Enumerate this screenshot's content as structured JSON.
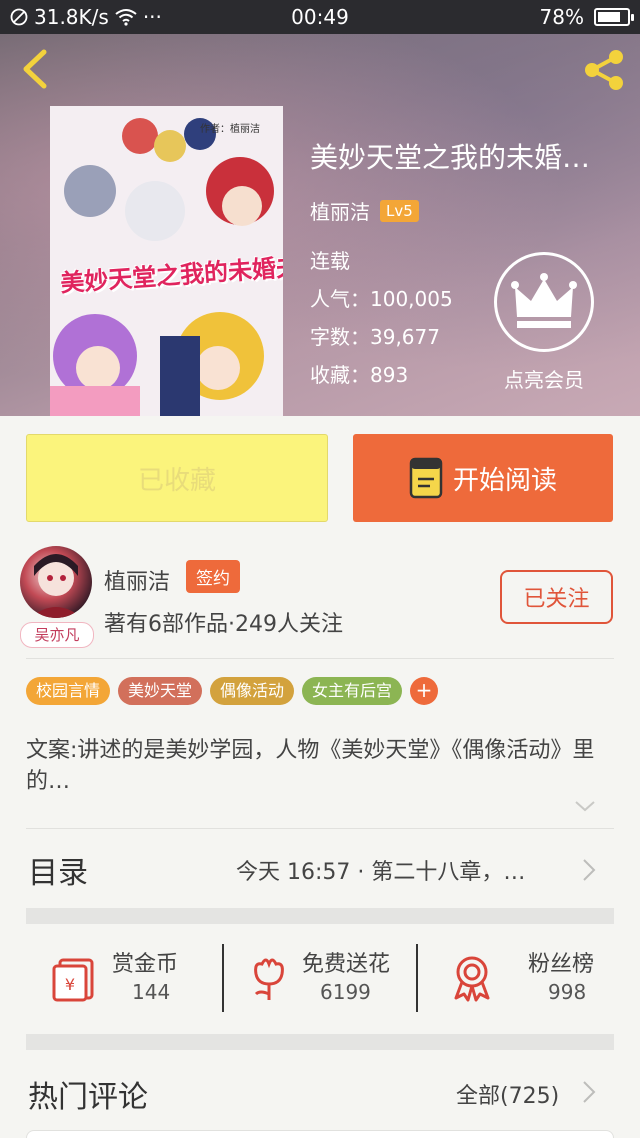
{
  "status_bar": {
    "speed": "31.8K/s",
    "dots": "···",
    "time": "00:49",
    "battery": "78%",
    "battery_level": 0.78
  },
  "book": {
    "title": "美妙天堂之我的未婚…",
    "author": "植丽洁",
    "level": "Lv5",
    "status": "连载",
    "popularity": "人气：100,005",
    "word_count": "字数：39,677",
    "favorites": "收藏：893",
    "cover_title_art": "美妙天堂之我的未婚夫之路",
    "cover_author": "作者：植丽洁",
    "vip_label": "点亮会员"
  },
  "actions": {
    "favorited_label": "已收藏",
    "read_label": "开始阅读"
  },
  "author_section": {
    "name": "植丽洁",
    "sign_badge": "签约",
    "info": "著有6部作品·249人关注",
    "avatar_tag": "吴亦凡",
    "follow_label": "已关注"
  },
  "tags": [
    {
      "label": "校园言情",
      "color": "#f3a637"
    },
    {
      "label": "美妙天堂",
      "color": "#d2705b"
    },
    {
      "label": "偶像活动",
      "color": "#d3a23d"
    },
    {
      "label": "女主有后宫",
      "color": "#8cb553"
    }
  ],
  "tag_plus": "+",
  "description": "文案:讲述的是美妙学园，人物《美妙天堂》《偶像活动》里的…",
  "toc": {
    "title": "目录",
    "latest": "今天 16:57 · 第二十八章，…"
  },
  "stats": {
    "reward": {
      "label": "赏金币",
      "value": "144",
      "icon": "red-envelope-icon"
    },
    "flowers": {
      "label": "免费送花",
      "value": "6199",
      "icon": "flower-icon"
    },
    "fans": {
      "label": "粉丝榜",
      "value": "998",
      "icon": "award-ribbon-icon"
    }
  },
  "comments": {
    "title": "热门评论",
    "all_label": "全部(725)"
  },
  "colors": {
    "accent_orange": "#ee6a3b",
    "fav_yellow": "#fbf47c",
    "level_badge": "#f3a637",
    "icon_red": "#d9453a"
  }
}
